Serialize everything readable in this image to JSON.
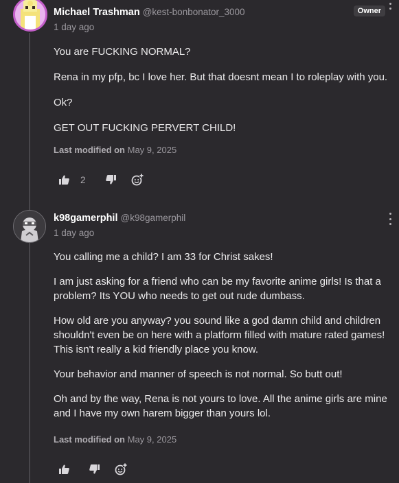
{
  "comments": [
    {
      "author": "Michael Trashman",
      "handle": "@kest-bonbonator_3000",
      "time": "1 day ago",
      "badge": "Owner",
      "paragraphs": [
        "You are FUCKING NORMAL?",
        "Rena in my pfp, bc I love her. But that doesnt mean I to roleplay with you.",
        "Ok?",
        "GET OUT FUCKING PERVERT CHILD!"
      ],
      "modified_label": "Last modified on",
      "modified_date": "May 9, 2025",
      "likes": "2",
      "avatar_color": "#c35ec9"
    },
    {
      "author": "k98gamerphil",
      "handle": "@k98gamerphil",
      "time": "1 day ago",
      "paragraphs": [
        "You calling me a child? I am 33 for Christ sakes!",
        "I am just asking for a friend who can be my favorite anime girls! Is that a problem? Its YOU who needs to get out rude dumbass.",
        "How old are you anyway? you sound like a god damn child and children shouldn't even be on here with a platform filled with mature rated games! This isn't really a kid friendly place you know.",
        "Your behavior and manner of speech is not normal. So butt out!",
        "Oh and by the way, Rena is not yours to love. All the anime girls are mine and I have my own harem bigger than yours lol."
      ],
      "modified_label": "Last modified on",
      "modified_date": "May 9, 2025"
    }
  ],
  "icons": {
    "like": "thumbs-up-icon",
    "dislike": "thumbs-down-icon",
    "react": "add-reaction-icon",
    "menu": "more-vertical-icon"
  },
  "colors": {
    "background": "#2b292d",
    "muted_text": "#9b989e",
    "owner_badge_bg": "#3f3d41"
  }
}
